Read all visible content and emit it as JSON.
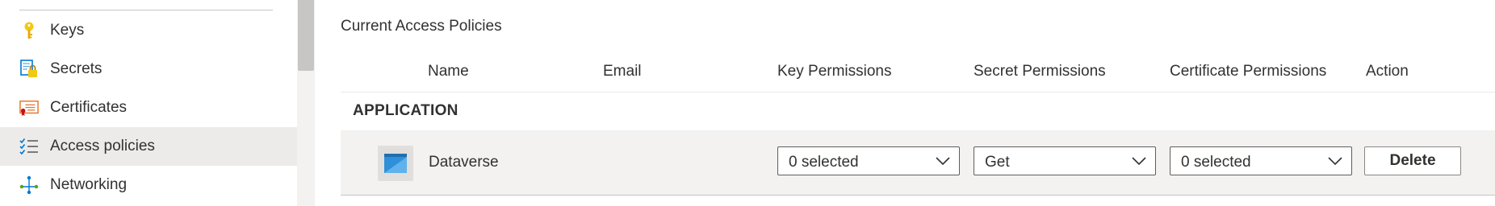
{
  "sidebar": {
    "items": [
      {
        "label": "Keys",
        "icon": "key-icon",
        "selected": false
      },
      {
        "label": "Secrets",
        "icon": "secret-icon",
        "selected": false
      },
      {
        "label": "Certificates",
        "icon": "certificate-icon",
        "selected": false
      },
      {
        "label": "Access policies",
        "icon": "access-policies-icon",
        "selected": true
      },
      {
        "label": "Networking",
        "icon": "networking-icon",
        "selected": false
      }
    ]
  },
  "main": {
    "section_title": "Current Access Policies",
    "columns": [
      "Name",
      "Email",
      "Key Permissions",
      "Secret Permissions",
      "Certificate Permissions",
      "Action"
    ],
    "groups": [
      {
        "label": "APPLICATION",
        "rows": [
          {
            "name": "Dataverse",
            "email": "",
            "key_permissions": "0 selected",
            "secret_permissions": "Get",
            "certificate_permissions": "0 selected",
            "action_label": "Delete"
          }
        ]
      }
    ]
  },
  "colors": {
    "selected_background": "#edebe9",
    "row_background": "#f3f2f1",
    "key_icon_color": "#f2c811",
    "secret_icon_color": "#0078d4",
    "certificate_icon_color": "#e8762b",
    "access_icon_color": "#0078d4"
  }
}
